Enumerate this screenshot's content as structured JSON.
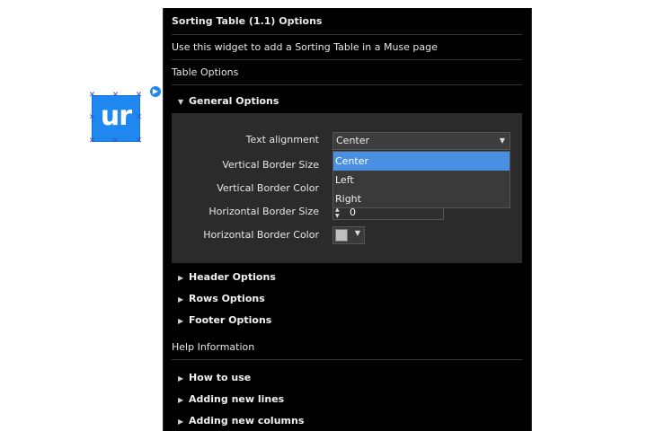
{
  "canvas": {
    "widget_thumbnail_text": "ur"
  },
  "panel": {
    "title": "Sorting Table (1.1) Options",
    "description": "Use this widget to add a Sorting Table in a Muse page",
    "table_options_label": "Table Options",
    "general": {
      "label": "General Options",
      "fields": {
        "text_alignment_label": "Text alignment",
        "text_alignment_value": "Center",
        "vertical_border_size_label": "Vertical Border Size",
        "vertical_border_color_label": "Vertical Border Color",
        "horizontal_border_size_label": "Horizontal Border Size",
        "horizontal_border_size_value": "0",
        "horizontal_border_color_label": "Horizontal Border Color"
      },
      "dropdown_options": [
        "Center",
        "Left",
        "Right"
      ],
      "selected_option": "Center"
    },
    "sections": {
      "header": "Header Options",
      "rows": "Rows Options",
      "footer": "Footer Options"
    },
    "help_label": "Help Information",
    "help_items": {
      "how_to_use": "How to use",
      "adding_lines": "Adding new lines",
      "adding_columns": "Adding new columns"
    }
  },
  "colors": {
    "panel_bg": "#000000",
    "section_bg": "#2b2b2b",
    "highlight": "#4a90e2",
    "thumbnail_blue": "#1e88f0",
    "color_swatch": "#bfbfbf"
  }
}
